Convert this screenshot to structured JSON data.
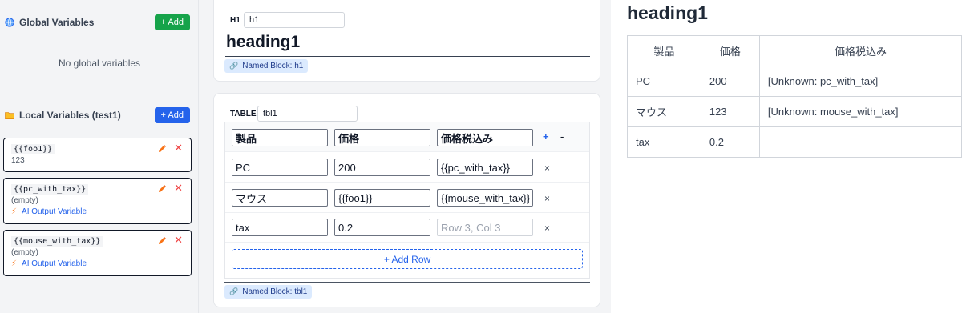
{
  "global_vars": {
    "title": "Global Variables",
    "add_label": "+ Add",
    "empty_text": "No global variables"
  },
  "local_vars": {
    "title": "Local Variables (test1)",
    "add_label": "+ Add",
    "items": [
      {
        "name": "{{foo1}}",
        "value": "123"
      },
      {
        "name": "{{pc_with_tax}}",
        "value": "(empty)",
        "ai_label": "AI Output Variable"
      },
      {
        "name": "{{mouse_with_tax}}",
        "value": "(empty)",
        "ai_label": "AI Output Variable"
      }
    ]
  },
  "heading_block": {
    "tag": "H1",
    "name_value": "h1",
    "text": "heading1",
    "named_block": "Named Block: h1"
  },
  "table_block": {
    "tag": "TABLE",
    "name_value": "tbl1",
    "headers": [
      "製品",
      "価格",
      "価格税込み"
    ],
    "add_col_label": "+",
    "remove_col_label": "-",
    "rows": [
      {
        "c1": "PC",
        "c2": "200",
        "c3": "{{pc_with_tax}}",
        "c3_placeholder": ""
      },
      {
        "c1": "マウス",
        "c2": "{{foo1}}",
        "c3": "{{mouse_with_tax}}",
        "c3_placeholder": ""
      },
      {
        "c1": "tax",
        "c2": "0.2",
        "c3": "",
        "c3_placeholder": "Row 3, Col 3"
      }
    ],
    "delete_row_label": "×",
    "add_row_label": "+ Add Row",
    "named_block": "Named Block: tbl1"
  },
  "preview": {
    "title": "heading1",
    "headers": [
      "製品",
      "価格",
      "価格税込み"
    ],
    "rows": [
      [
        "PC",
        "200",
        "[Unknown: pc_with_tax]"
      ],
      [
        "マウス",
        "123",
        "[Unknown: mouse_with_tax]"
      ],
      [
        "tax",
        "0.2",
        ""
      ]
    ]
  },
  "colors": {
    "accent_blue": "#2563eb",
    "add_green": "#16a34a",
    "delete_red": "#ef4444",
    "edit_orange": "#f97316"
  },
  "icons": [
    "globe-icon",
    "folder-icon",
    "pencil-icon",
    "close-icon",
    "bolt-icon",
    "link-icon"
  ]
}
